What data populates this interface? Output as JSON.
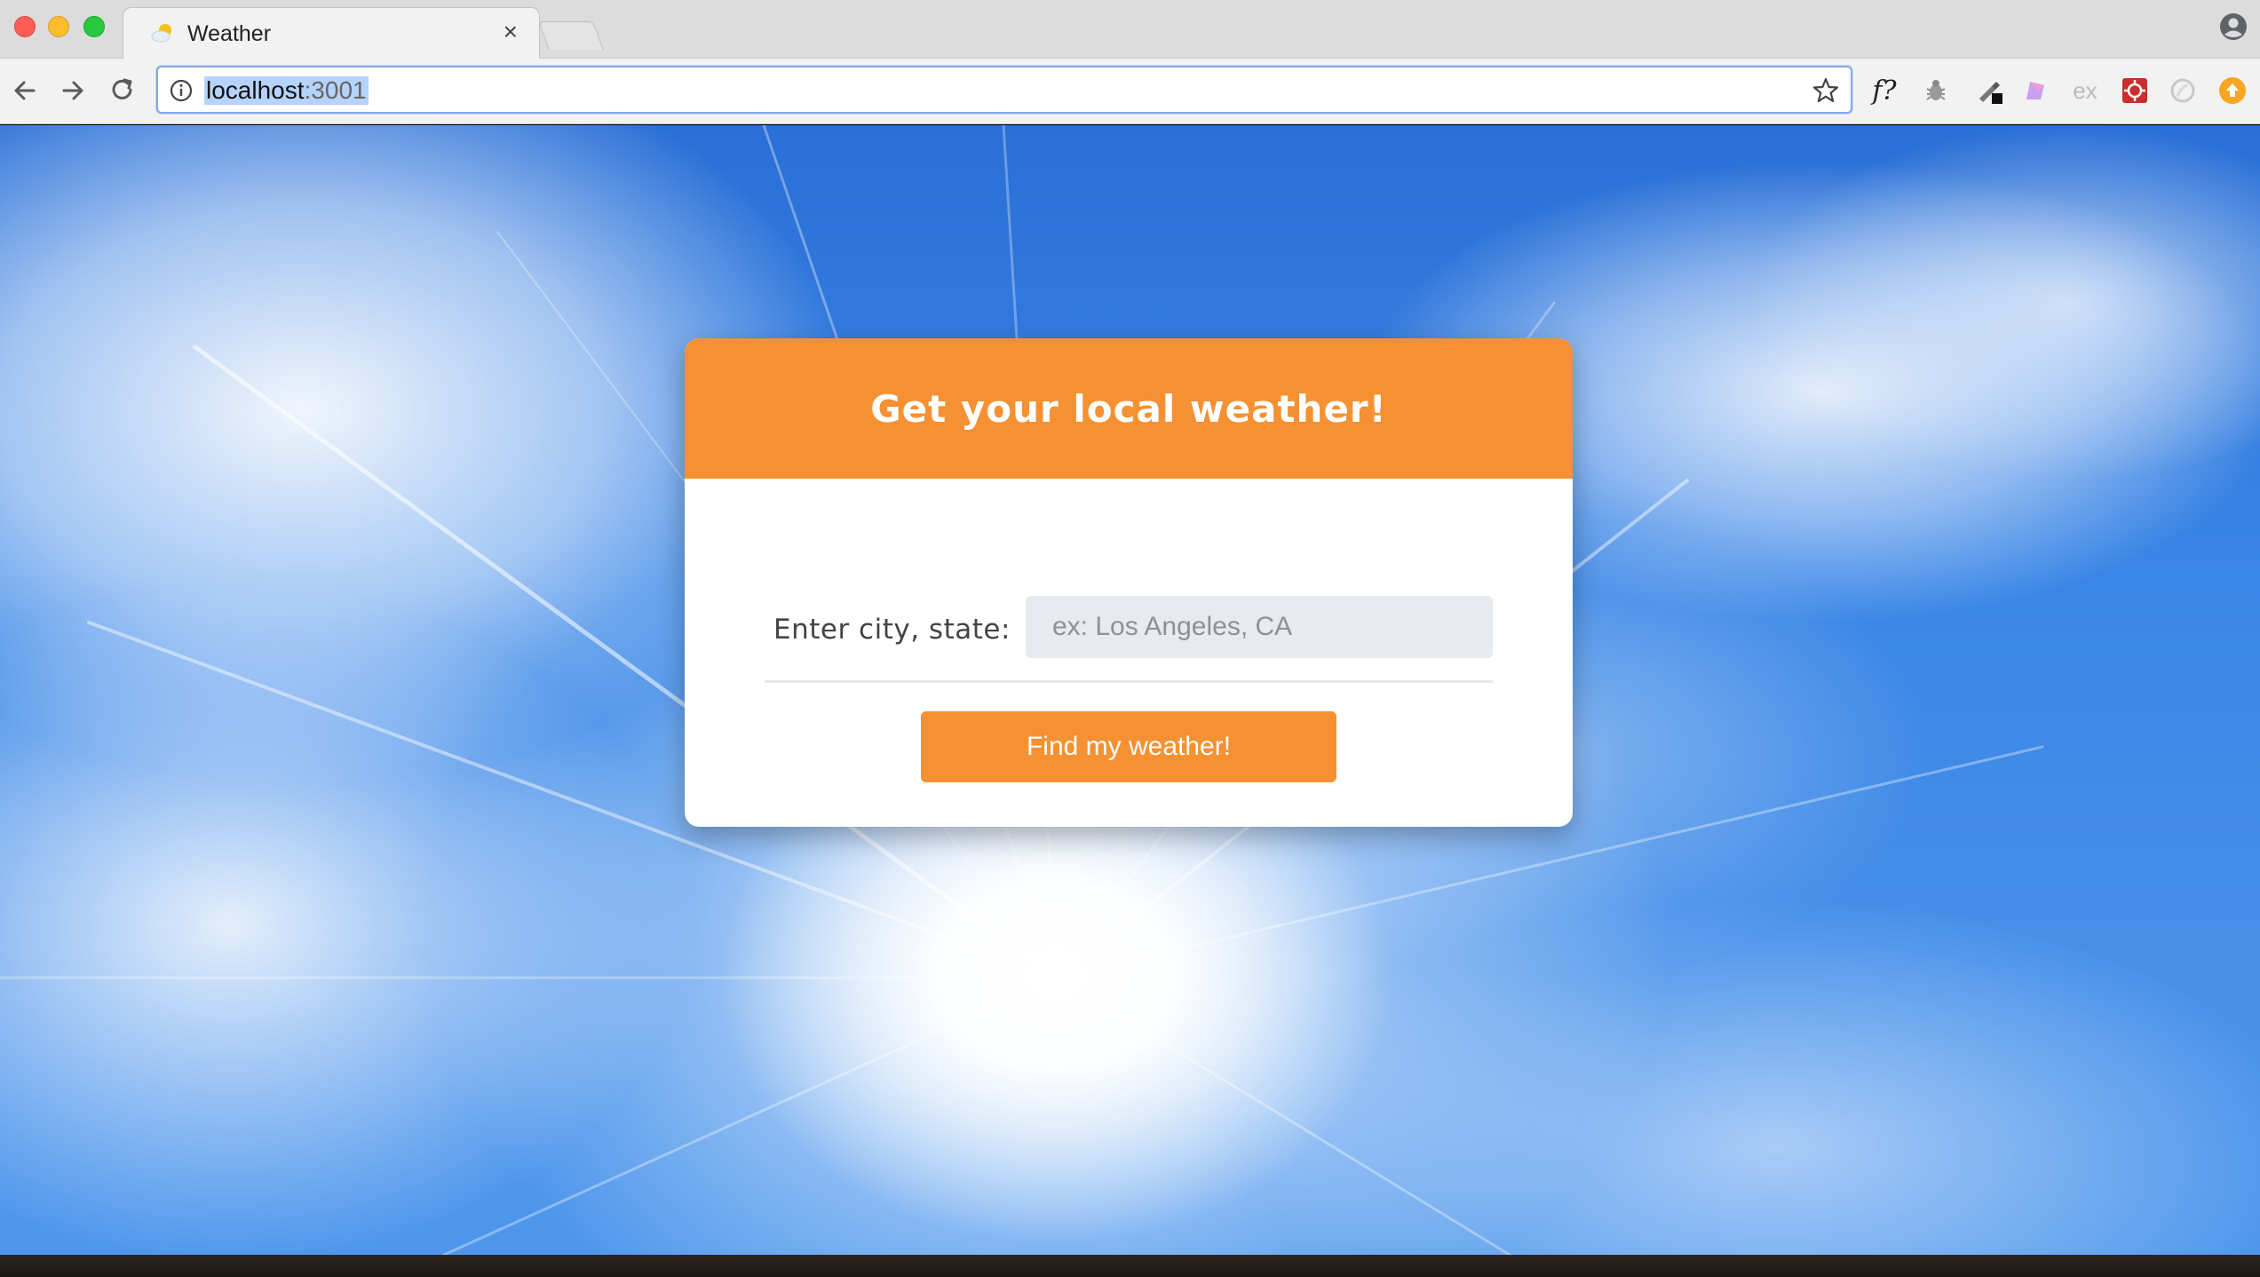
{
  "browser": {
    "tab": {
      "title": "Weather",
      "close_label": "×",
      "favicon": "sun-cloud-icon"
    },
    "address_bar": {
      "host": "localhost",
      "port": ":3001"
    },
    "extensions": {
      "fx_label": "f?",
      "ex_label": "ex"
    }
  },
  "card": {
    "title": "Get your local weather!",
    "field_label": "Enter city, state:",
    "input_placeholder": "ex: Los Angeles, CA",
    "input_value": "",
    "button_label": "Find my weather!"
  },
  "colors": {
    "accent": "#f59132",
    "sky": "#3a86e6",
    "input_bg": "#e7eaee",
    "card_bg": "#ffffff"
  }
}
